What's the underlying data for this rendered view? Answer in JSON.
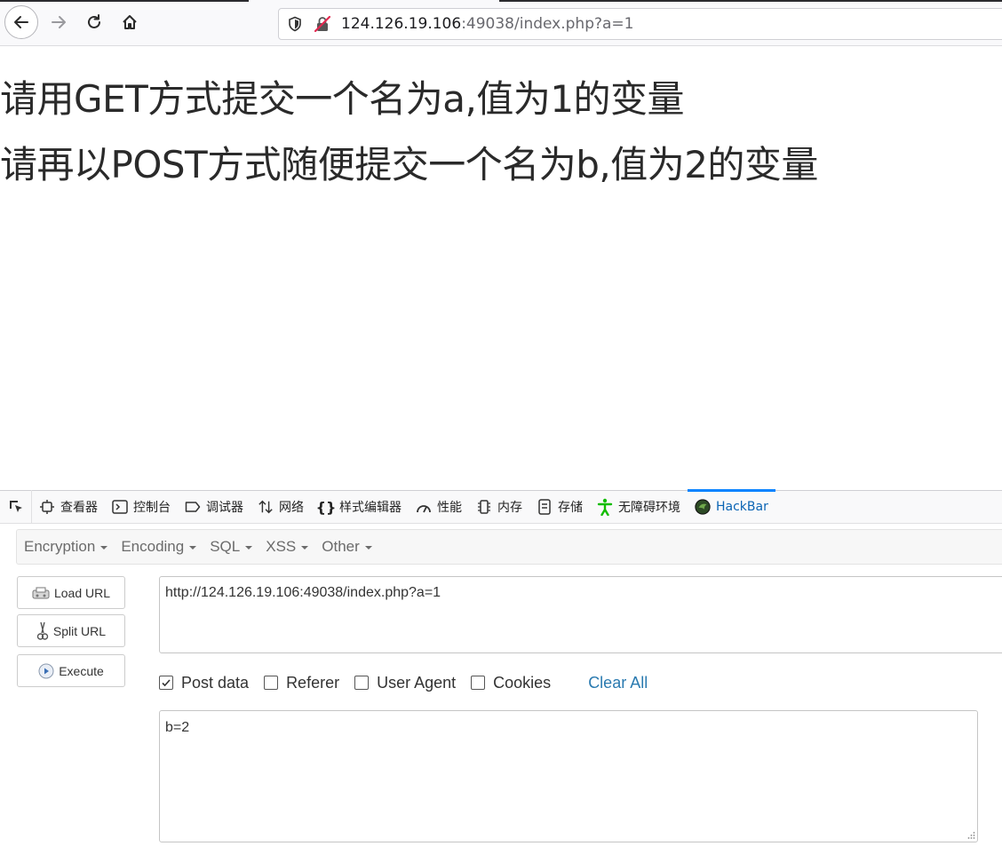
{
  "browser": {
    "url_host": "124.126.19.106",
    "url_rest": ":49038/index.php?a=1",
    "icons": [
      "back-icon",
      "forward-icon",
      "reload-icon",
      "home-icon",
      "shield-icon",
      "insecure-lock-icon"
    ]
  },
  "page": {
    "line1": "请用GET方式提交一个名为a,值为1的变量",
    "line2": "请再以POST方式随便提交一个名为b,值为2的变量"
  },
  "devtools": {
    "tabs": [
      {
        "label": "查看器",
        "icon": "inspector-icon"
      },
      {
        "label": "控制台",
        "icon": "console-icon"
      },
      {
        "label": "调试器",
        "icon": "debugger-icon"
      },
      {
        "label": "网络",
        "icon": "network-icon"
      },
      {
        "label": "样式编辑器",
        "icon": "style-editor-icon"
      },
      {
        "label": "性能",
        "icon": "performance-icon"
      },
      {
        "label": "内存",
        "icon": "memory-icon"
      },
      {
        "label": "存储",
        "icon": "storage-icon"
      },
      {
        "label": "无障碍环境",
        "icon": "accessibility-icon"
      },
      {
        "label": "HackBar",
        "icon": "hackbar-icon",
        "active": true
      }
    ],
    "active_color": "#0a84ff"
  },
  "hackbar": {
    "menu": [
      "Encryption",
      "Encoding",
      "SQL",
      "XSS",
      "Other"
    ],
    "buttons": {
      "load": "Load URL",
      "split": "Split URL",
      "execute": "Execute"
    },
    "url_value": "http://124.126.19.106:49038/index.php?a=1",
    "options": {
      "post_data": {
        "label": "Post data",
        "checked": true
      },
      "referer": {
        "label": "Referer",
        "checked": false
      },
      "user_agent": {
        "label": "User Agent",
        "checked": false
      },
      "cookies": {
        "label": "Cookies",
        "checked": false
      }
    },
    "clear_all": "Clear All",
    "post_value": "b=2",
    "link_color": "#2a7ab0"
  }
}
